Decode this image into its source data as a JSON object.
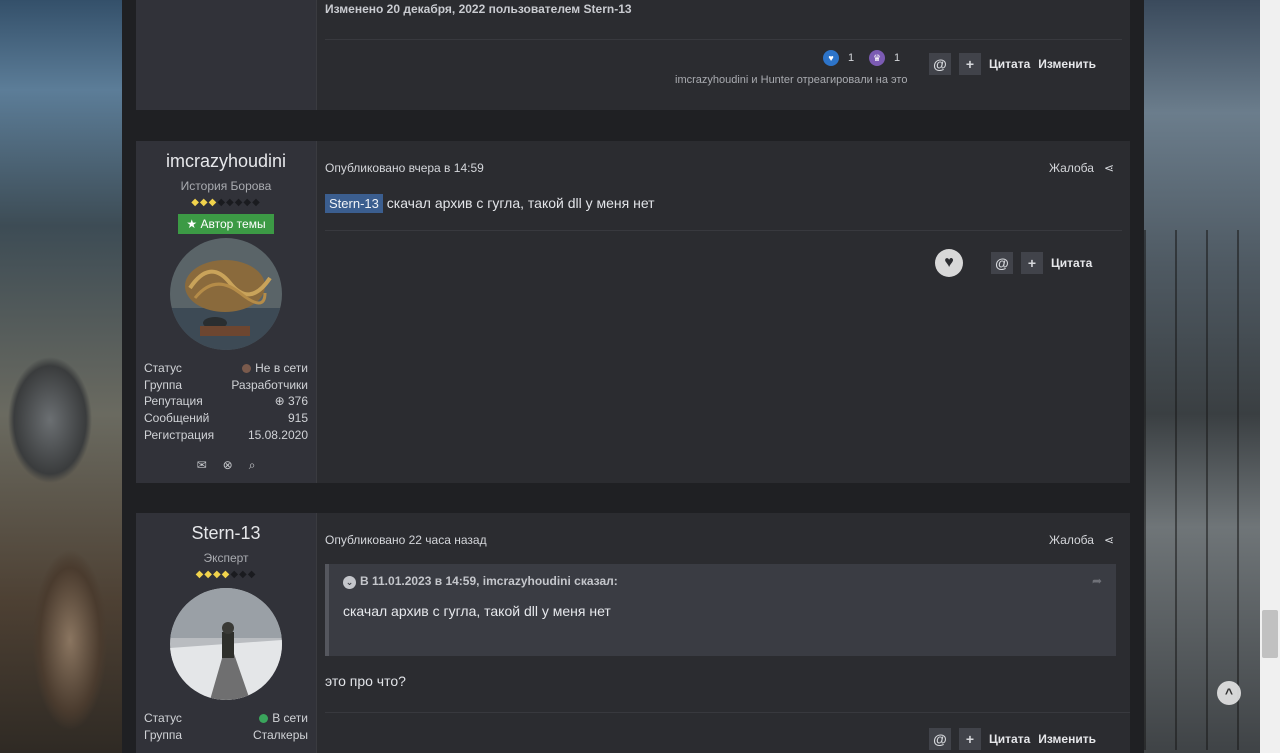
{
  "post_prev": {
    "edited": "Изменено 20 декабря, 2022 пользователем Stern-13",
    "reactions": [
      {
        "icon": "heart-reaction-icon",
        "count": "1",
        "color": "#2d74c9"
      },
      {
        "icon": "trophy-reaction-icon",
        "count": "1",
        "color": "#7b5bb3"
      }
    ],
    "reacted_text": "imcrazyhoudini и Hunter отреагировали на это",
    "mention_btn": "@",
    "multiquote_btn": "+",
    "quote_label": "Цитата",
    "edit_label": "Изменить"
  },
  "post1": {
    "author": {
      "name": "imcrazyhoudini",
      "title": "История Борова",
      "pips_on": "◆◆◆",
      "pips_off": "◆◆◆◆◆",
      "badge": "Автор темы",
      "stats": [
        {
          "k": "Статус",
          "v": "Не в сети",
          "dot": "#7a5a4c"
        },
        {
          "k": "Группа",
          "v": "Разработчики"
        },
        {
          "k": "Репутация",
          "v": "376",
          "positive": true
        },
        {
          "k": "Сообщений",
          "v": "915"
        },
        {
          "k": "Регистрация",
          "v": "15.08.2020"
        }
      ]
    },
    "published": "Опубликовано вчера в 14:59",
    "report": "Жалоба",
    "mention": "Stern-13",
    "text": "скачал архив с гугла, такой dll у меня нет",
    "mention_btn": "@",
    "multiquote_btn": "+",
    "quote_label": "Цитата"
  },
  "post2": {
    "author": {
      "name": "Stern-13",
      "title": "Эксперт",
      "pips_on": "◆◆◆◆",
      "pips_off": "◆◆◆",
      "stats": [
        {
          "k": "Статус",
          "v": "В сети",
          "dot": "#3aa55c"
        },
        {
          "k": "Группа",
          "v": "Сталкеры"
        }
      ]
    },
    "published": "Опубликовано 22 часа назад",
    "report": "Жалоба",
    "quote_head": "В 11.01.2023 в 14:59, imcrazyhoudini сказал:",
    "quote_body": "скачал архив с гугла, такой dll у меня нет",
    "text": "это про что?",
    "mention_btn": "@",
    "multiquote_btn": "+",
    "quote_label": "Цитата",
    "edit_label": "Изменить"
  },
  "scroll_top": "^"
}
